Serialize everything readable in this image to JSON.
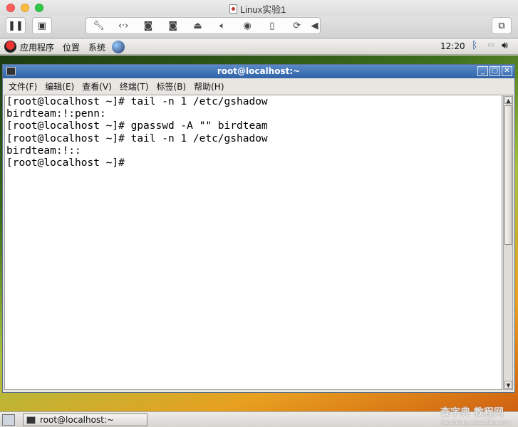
{
  "vm_window": {
    "title": "Linux实验1",
    "toolbar_icons": [
      "pause-icon",
      "snapshot-icon",
      "settings-wrench-icon",
      "network-icon",
      "disk1-icon",
      "disk2-icon",
      "printer-icon",
      "audio-icon",
      "camera-icon",
      "mouse-icon",
      "sync-icon",
      "collapse-arrow-icon",
      "fullscreen-icon"
    ]
  },
  "gnome_panel": {
    "menus": [
      "应用程序",
      "位置",
      "系统"
    ],
    "clock": "12:20"
  },
  "terminal": {
    "title": "root@localhost:~",
    "menu": [
      "文件(F)",
      "编辑(E)",
      "查看(V)",
      "终端(T)",
      "标签(B)",
      "帮助(H)"
    ],
    "lines": [
      "[root@localhost ~]# tail -n 1 /etc/gshadow",
      "birdteam:!:penn:",
      "[root@localhost ~]# gpasswd -A \"\" birdteam",
      "[root@localhost ~]# tail -n 1 /etc/gshadow",
      "birdteam:!::",
      "[root@localhost ~]#"
    ]
  },
  "taskbar": {
    "items": [
      "root@localhost:~"
    ]
  },
  "watermark": {
    "main": "查字典 教程网",
    "sub": "jiaocheng.chazidian.com"
  }
}
